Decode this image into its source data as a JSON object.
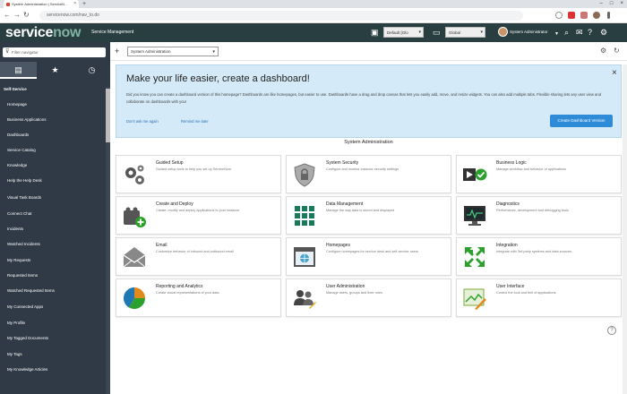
{
  "browser": {
    "tab_title": "System Administration | ServiceN…",
    "tab_close": "×",
    "new_tab": "+",
    "window_controls": [
      "–",
      "□",
      "×"
    ],
    "url": "servicenow.com/nav_to.do",
    "nav": {
      "back": "←",
      "forward": "→",
      "reload": "↻",
      "home": "⌂"
    }
  },
  "header": {
    "logo_service": "service",
    "logo_now": "now",
    "app_title": "Service Management",
    "update_set": "Default [Glo",
    "scope": "Global",
    "user": "System Administrator",
    "user_caret": "▾"
  },
  "sidebar": {
    "filter_placeholder": "Filter navigator",
    "tabs": [
      "▤",
      "★",
      "◷"
    ],
    "section": "Self-Service",
    "items": [
      "Homepage",
      "Business Applications",
      "Dashboards",
      "Service Catalog",
      "Knowledge",
      "Help the Help Desk",
      "Visual Task Boards",
      "Connect Chat",
      "Incidents",
      "Watched Incidents",
      "My Requests",
      "Requested Items",
      "Watched Requested Items",
      "My Connected Apps",
      "My Profile",
      "My Tagged Documents",
      "My Tags",
      "My Knowledge Articles"
    ]
  },
  "toolbar": {
    "add": "+",
    "dashboard_select": "System Administration"
  },
  "banner": {
    "title": "Make your life easier, create a dashboard!",
    "text": "Did you know you can create a dashboard version of this homepage? Dashboards are like homepages, but easier to use. Dashboards have a drag and drop canvas that lets you easily add, move, and resize widgets. You can also add multiple tabs. Flexible sharing lets any user view and collaborate on dashboards with you!",
    "link1": "Don't ask me again",
    "link2": "Remind me later",
    "button": "Create Dashboard Version",
    "close": "×"
  },
  "section_title": "System Administration",
  "cards": [
    {
      "title": "Guided Setup",
      "desc": "Guided setup tools to help you set up ServiceNow",
      "icon": "gears-icon"
    },
    {
      "title": "System Security",
      "desc": "Configure and monitor instance security settings",
      "icon": "shield-icon"
    },
    {
      "title": "Business Logic",
      "desc": "Manage workflow and behavior of applications",
      "icon": "play-check-icon"
    },
    {
      "title": "Create and Deploy",
      "desc": "Create, modify and deploy applications to your instance",
      "icon": "blocks-plus-icon"
    },
    {
      "title": "Data Management",
      "desc": "Manage the way data is stored and displayed",
      "icon": "grid-icon"
    },
    {
      "title": "Diagnostics",
      "desc": "Performance, development and debugging tools",
      "icon": "monitor-icon"
    },
    {
      "title": "Email",
      "desc": "Customize behavior of inbound and outbound email",
      "icon": "envelope-icon"
    },
    {
      "title": "Homepages",
      "desc": "Configure homepages for service desk and self-service users",
      "icon": "browser-icon"
    },
    {
      "title": "Integration",
      "desc": "Integrate with 3rd party systems and data sources",
      "icon": "arrows-icon"
    },
    {
      "title": "Reporting and Analytics",
      "desc": "Create visual representations of your data",
      "icon": "pie-chart-icon"
    },
    {
      "title": "User Administration",
      "desc": "Manage users, groups and their roles",
      "icon": "users-icon"
    },
    {
      "title": "User Interface",
      "desc": "Control the look and feel of applications",
      "icon": "paint-icon"
    }
  ],
  "help": "?"
}
